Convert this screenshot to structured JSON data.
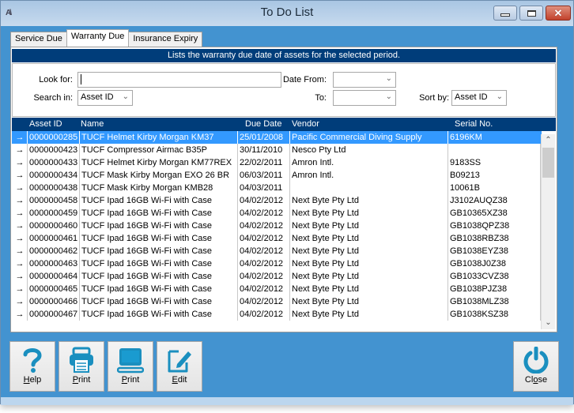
{
  "window": {
    "title": "To Do List",
    "app_icon": "A\\",
    "controls": {
      "minimize": "minimize",
      "maximize": "maximize",
      "close": "✕"
    }
  },
  "tabs": [
    {
      "label": "Service Due",
      "active": false
    },
    {
      "label": "Warranty Due",
      "active": true
    },
    {
      "label": "Insurance Expiry",
      "active": false
    }
  ],
  "banner": "Lists the warranty due date of assets for the selected period.",
  "filters": {
    "look_for_label": "Look for:",
    "look_for_value": "",
    "search_in_label": "Search in:",
    "search_in_value": "Asset ID",
    "date_from_label": "Date From:",
    "date_from_value": "",
    "to_label": "To:",
    "to_value": "",
    "sort_by_label": "Sort by:",
    "sort_by_value": "Asset ID"
  },
  "grid": {
    "columns": [
      "Asset ID",
      "Name",
      "Due Date",
      "Vendor",
      "Serial No."
    ],
    "row_marker": "→",
    "selected_index": 0,
    "rows": [
      {
        "id": "0000000285",
        "name": "TUCF Helmet Kirby Morgan KM37",
        "due": "25/01/2008",
        "vendor": "Pacific Commercial Diving Supply",
        "serial": "6196KM"
      },
      {
        "id": "0000000423",
        "name": "TUCF Compressor Airmac B35P",
        "due": "30/11/2010",
        "vendor": "Nesco Pty Ltd",
        "serial": ""
      },
      {
        "id": "0000000433",
        "name": "TUCF Helmet Kirby Morgan KM77REX",
        "due": "22/02/2011",
        "vendor": "Amron Intl.",
        "serial": "9183SS"
      },
      {
        "id": "0000000434",
        "name": "TUCF Mask Kirby Morgan EXO 26 BR",
        "due": "06/03/2011",
        "vendor": "Amron Intl.",
        "serial": "B09213"
      },
      {
        "id": "0000000438",
        "name": "TUCF Mask Kirby Morgan KMB28",
        "due": "04/03/2011",
        "vendor": "",
        "serial": "10061B"
      },
      {
        "id": "0000000458",
        "name": "TUCF Ipad 16GB Wi-Fi with Case",
        "due": "04/02/2012",
        "vendor": "Next Byte Pty Ltd",
        "serial": "J3102AUQZ38"
      },
      {
        "id": "0000000459",
        "name": "TUCF Ipad 16GB Wi-Fi with Case",
        "due": "04/02/2012",
        "vendor": "Next Byte Pty Ltd",
        "serial": "GB10365XZ38"
      },
      {
        "id": "0000000460",
        "name": "TUCF Ipad 16GB Wi-Fi with Case",
        "due": "04/02/2012",
        "vendor": "Next Byte Pty Ltd",
        "serial": "GB1038QPZ38"
      },
      {
        "id": "0000000461",
        "name": "TUCF Ipad 16GB Wi-Fi with Case",
        "due": "04/02/2012",
        "vendor": "Next Byte Pty Ltd",
        "serial": "GB1038RBZ38"
      },
      {
        "id": "0000000462",
        "name": "TUCF Ipad 16GB Wi-Fi with Case",
        "due": "04/02/2012",
        "vendor": "Next Byte Pty Ltd",
        "serial": "GB1038EYZ38"
      },
      {
        "id": "0000000463",
        "name": "TUCF Ipad 16GB Wi-Fi with Case",
        "due": "04/02/2012",
        "vendor": "Next Byte Pty Ltd",
        "serial": "GB1038J0Z38"
      },
      {
        "id": "0000000464",
        "name": "TUCF Ipad 16GB Wi-Fi with Case",
        "due": "04/02/2012",
        "vendor": "Next Byte Pty Ltd",
        "serial": "GB1033CVZ38"
      },
      {
        "id": "0000000465",
        "name": "TUCF Ipad 16GB Wi-Fi with Case",
        "due": "04/02/2012",
        "vendor": "Next Byte Pty Ltd",
        "serial": "GB1038PJZ38"
      },
      {
        "id": "0000000466",
        "name": "TUCF Ipad 16GB Wi-Fi with Case",
        "due": "04/02/2012",
        "vendor": "Next Byte Pty Ltd",
        "serial": "GB1038MLZ38"
      },
      {
        "id": "0000000467",
        "name": "TUCF Ipad 16GB Wi-Fi with Case",
        "due": "04/02/2012",
        "vendor": "Next Byte Pty Ltd",
        "serial": "GB1038KSZ38"
      }
    ]
  },
  "buttons": {
    "help": {
      "access": "H",
      "rest": "elp",
      "icon": "help-icon"
    },
    "print_printer": {
      "access": "P",
      "rest": "rint",
      "icon": "printer-icon"
    },
    "print_screen": {
      "access": "P",
      "rest": "rint",
      "icon": "monitor-icon"
    },
    "edit": {
      "access": "E",
      "rest": "dit",
      "icon": "edit-icon"
    },
    "close": {
      "pre": "Cl",
      "access": "o",
      "rest": "se",
      "icon": "power-icon"
    }
  },
  "colors": {
    "window_bg": "#4393d0",
    "banner_bg": "#003d7a",
    "selection": "#3399ff",
    "icon_accent": "#1a8fbf"
  }
}
